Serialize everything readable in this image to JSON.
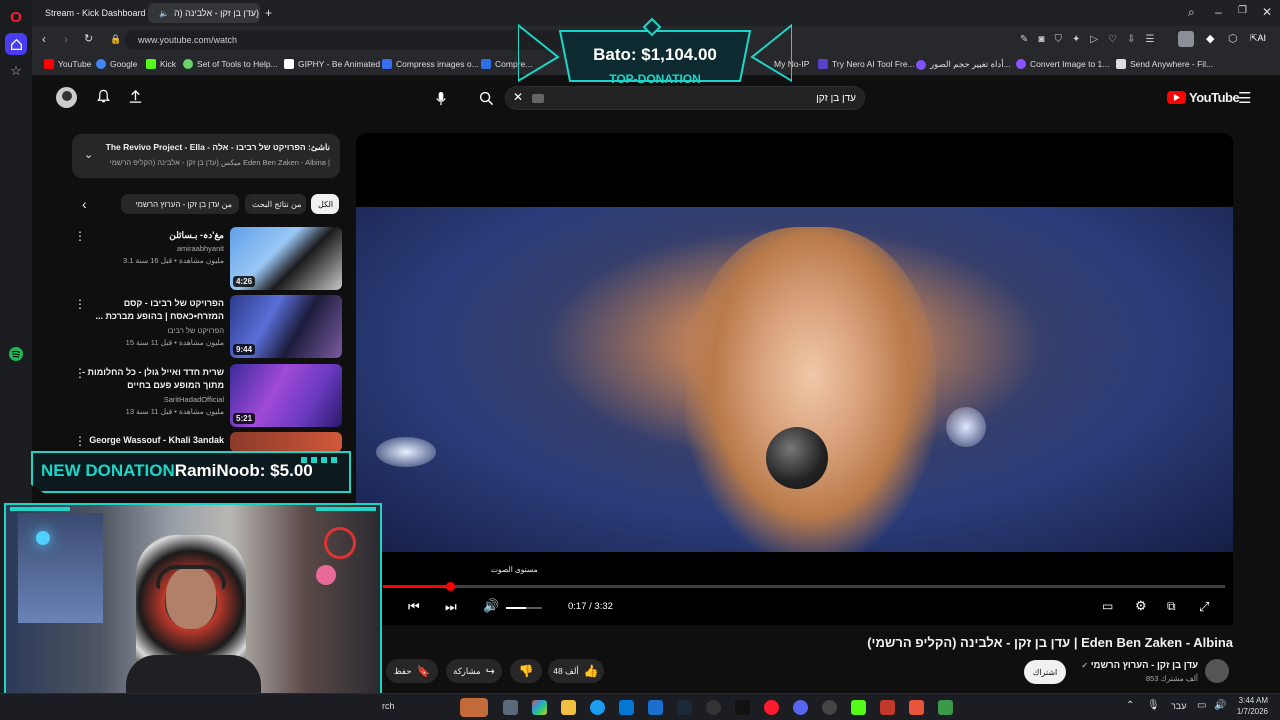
{
  "browser": {
    "tabs": [
      {
        "label": "Stream - Kick Dashboard",
        "active": false
      },
      {
        "label": "(עדן בן זקן - אלבינה (ה",
        "active": true
      }
    ],
    "url": "www.youtube.com/watch",
    "assistant_label": "AI",
    "bookmarks": [
      {
        "label": "YouTube",
        "color": "#ff0000"
      },
      {
        "label": "Google",
        "color": "#4285f4"
      },
      {
        "label": "Kick",
        "color": "#53fc18"
      },
      {
        "label": "Set of Tools to Help...",
        "color": "#6bd36b"
      },
      {
        "label": "GIPHY - Be Animated",
        "color": "#ffffff"
      },
      {
        "label": "Compress images o...",
        "color": "#3a6df0"
      },
      {
        "label": "Compre...",
        "color": "#2f6fe4"
      },
      {
        "label": "My No-IP",
        "color": "#444444"
      },
      {
        "label": "Try Nero AI Tool Fre...",
        "color": "#5a3fc9"
      },
      {
        "label": "أداة تغيير حجم الصور...",
        "color": "#7d52ff"
      },
      {
        "label": "Convert Image to 1...",
        "color": "#8c52ff"
      },
      {
        "label": "Send Anywhere - Fil...",
        "color": "#dddddd"
      }
    ]
  },
  "youtube": {
    "logo_text": "YouTube",
    "search_query": "עדן בן זקן",
    "mix": {
      "title": "The Revivo Project - Ella - ناشئ: הפרויקט של רביבו - אלה",
      "subtitle": "ميكس (עדן בן זקן - אלבינה (הקליפ הרשמי Eden Ben Zaken - Albina |"
    },
    "chips": [
      "الكل",
      "من نتائج البحث",
      "من עדן בן זקן - הערוץ הרשמי"
    ],
    "recommendations": [
      {
        "title": "مغ'دہ- بـسائلن",
        "channel": "amiraabhyanit",
        "meta": "3.1 مليون مشاهدة • قبل 16 سنة",
        "duration": "4:26"
      },
      {
        "title": "הפרויקט של רביבו - קסם המזרח•כאסח | בהופע מברכת ...",
        "channel": "הפרויקט של רביבו",
        "meta": "15 مليون مشاهدة • قبل 11 سنة",
        "duration": "9:44"
      },
      {
        "title": "שרית חדד ואייל גולן - כל החלומות - מתוך המופע פעם בחיים",
        "channel": "SaritHadadOfficial",
        "meta": "13 مليون مشاهدة • قبل 11 سنة",
        "duration": "5:21"
      },
      {
        "title": "George Wassouf - Khali 3andak",
        "channel": "",
        "meta": "",
        "duration": ""
      }
    ],
    "player": {
      "tooltip": "مستوى الصوت",
      "time_current": "0:17",
      "time_total": "3:32",
      "progress": 0.08,
      "volume": 0.55
    },
    "video_title": "(עדן בן זקן - אלבינה (הקליפ הרשמי | Eden Ben Zaken - Albina",
    "channel_name": "עדן בן זקן - הערוץ הרשמי",
    "subscribers": "853 ألف مشترك",
    "subscribe_label": "اشتراك",
    "likes_label": "48 ألف",
    "share_label": "مشاركة",
    "save_label": "حفظ"
  },
  "overlays": {
    "top_donation_amount": "Bato: $1,104.00",
    "top_donation_label": "TOP-DONATION",
    "new_donation_label": "NEW DONATION",
    "new_donation_text": "RamiNoob: $5.00"
  },
  "taskbar": {
    "search_text": "rch",
    "language": "עבר",
    "time": "3:44 AM",
    "date": "1/7/2026"
  },
  "colors": {
    "accent_teal": "#1bd6c7",
    "youtube_red": "#ff0000",
    "opera_red": "#ff1b2d"
  }
}
